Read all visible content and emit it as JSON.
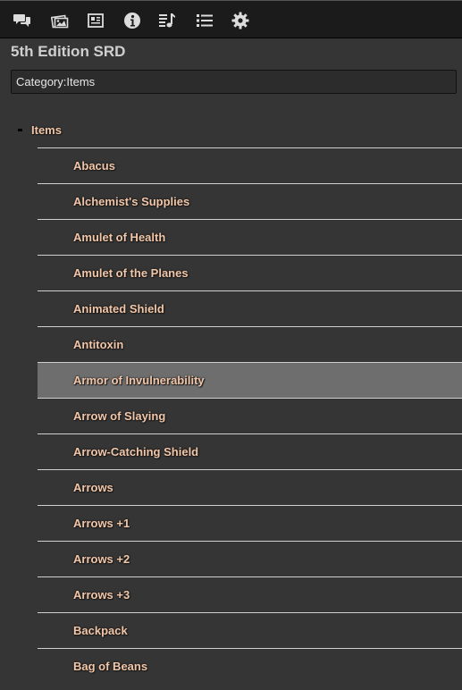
{
  "toolbar": {
    "icons": [
      {
        "name": "chat-icon"
      },
      {
        "name": "art-library-icon"
      },
      {
        "name": "journal-icon"
      },
      {
        "name": "info-icon"
      },
      {
        "name": "jukebox-icon"
      },
      {
        "name": "list-icon"
      },
      {
        "name": "gear-icon"
      }
    ],
    "icon_color": "#dcdcdc"
  },
  "panel": {
    "title": "5th Edition SRD",
    "search_value": "Category:Items"
  },
  "tree": {
    "root_label": "Items",
    "items": [
      "Abacus",
      "Alchemist's Supplies",
      "Amulet of Health",
      "Amulet of the Planes",
      "Animated Shield",
      "Antitoxin",
      "Armor of Invulnerability",
      "Arrow of Slaying",
      "Arrow-Catching Shield",
      "Arrows",
      "Arrows +1",
      "Arrows +2",
      "Arrows +3",
      "Backpack",
      "Bag of Beans"
    ],
    "highlighted_item": "Armor of Invulnerability"
  },
  "colors": {
    "link": "#f2c6a8",
    "highlight": "#6e6e6e",
    "background": "#353535",
    "toolbar": "#1b1b1b"
  }
}
